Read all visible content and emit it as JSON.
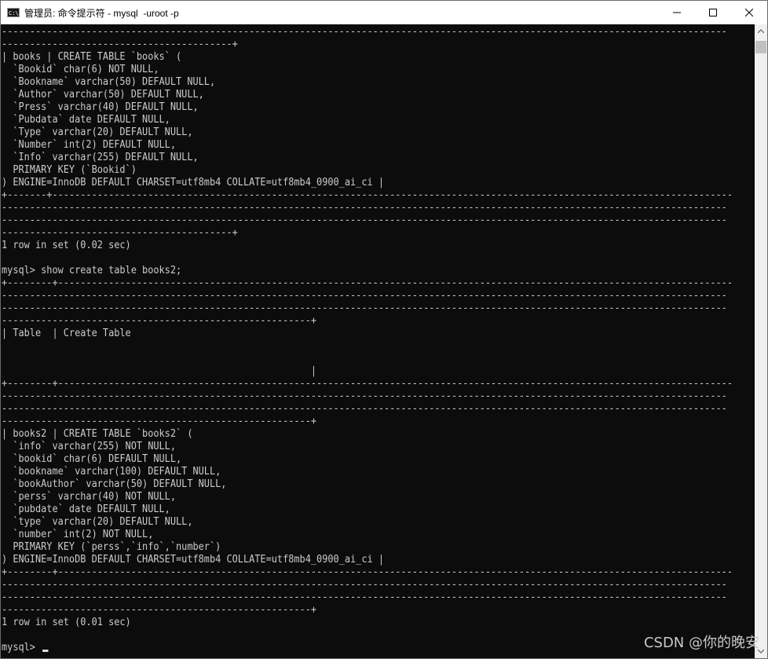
{
  "window": {
    "title": "管理员: 命令提示符 - mysql  -uroot -p",
    "app_icon_text": "C:\\"
  },
  "terminal": {
    "lines": [
      "---------------------------------------------------------------------------------------------------------------------------------",
      "-----------------------------------------+",
      "| books | CREATE TABLE `books` (",
      "  `Bookid` char(6) NOT NULL,",
      "  `Bookname` varchar(50) DEFAULT NULL,",
      "  `Author` varchar(50) DEFAULT NULL,",
      "  `Press` varchar(40) DEFAULT NULL,",
      "  `Pubdata` date DEFAULT NULL,",
      "  `Type` varchar(20) DEFAULT NULL,",
      "  `Number` int(2) DEFAULT NULL,",
      "  `Info` varchar(255) DEFAULT NULL,",
      "  PRIMARY KEY (`Bookid`)",
      ") ENGINE=InnoDB DEFAULT CHARSET=utf8mb4 COLLATE=utf8mb4_0900_ai_ci |",
      "+-------+-------------------------------------------------------------------------------------------------------------------------",
      "---------------------------------------------------------------------------------------------------------------------------------",
      "---------------------------------------------------------------------------------------------------------------------------------",
      "-----------------------------------------+",
      "1 row in set (0.02 sec)",
      "",
      "mysql> show create table books2;",
      "+--------+------------------------------------------------------------------------------------------------------------------------",
      "---------------------------------------------------------------------------------------------------------------------------------",
      "---------------------------------------------------------------------------------------------------------------------------------",
      "-------------------------------------------------------+",
      "| Table  | Create Table",
      "",
      "",
      "                                                       |",
      "+--------+------------------------------------------------------------------------------------------------------------------------",
      "---------------------------------------------------------------------------------------------------------------------------------",
      "---------------------------------------------------------------------------------------------------------------------------------",
      "-------------------------------------------------------+",
      "| books2 | CREATE TABLE `books2` (",
      "  `info` varchar(255) NOT NULL,",
      "  `bookid` char(6) DEFAULT NULL,",
      "  `bookname` varchar(100) DEFAULT NULL,",
      "  `bookAuthor` varchar(50) DEFAULT NULL,",
      "  `perss` varchar(40) NOT NULL,",
      "  `pubdate` date DEFAULT NULL,",
      "  `type` varchar(20) DEFAULT NULL,",
      "  `number` int(2) NOT NULL,",
      "  PRIMARY KEY (`perss`,`info`,`number`)",
      ") ENGINE=InnoDB DEFAULT CHARSET=utf8mb4 COLLATE=utf8mb4_0900_ai_ci |",
      "+--------+------------------------------------------------------------------------------------------------------------------------",
      "---------------------------------------------------------------------------------------------------------------------------------",
      "---------------------------------------------------------------------------------------------------------------------------------",
      "-------------------------------------------------------+",
      "1 row in set (0.01 sec)",
      "",
      "mysql> "
    ]
  },
  "watermark": "CSDN @你的晚安",
  "colors": {
    "terminal_bg": "#0c0c0c",
    "terminal_fg": "#cccccc",
    "titlebar_bg": "#ffffff"
  }
}
